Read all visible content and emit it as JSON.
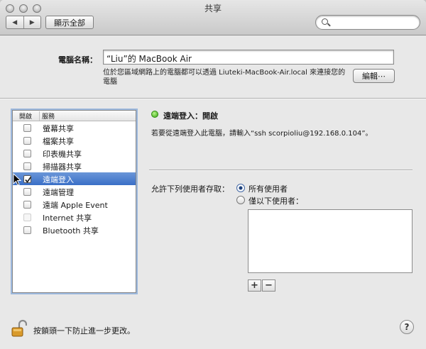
{
  "window": {
    "title": "共享"
  },
  "toolbar": {
    "back": "◀",
    "forward": "▶",
    "show_all": "顯示全部",
    "search_value": "",
    "search_placeholder": ""
  },
  "computer_name": {
    "label": "電腦名稱：",
    "value": "“Liu”的 MacBook Air",
    "address_note": "位於您區域網路上的電腦都可以透過 Liuteki-MacBook-Air.local 來連接您的電腦",
    "edit_button": "編輯⋯"
  },
  "services": {
    "col_on": "開啟",
    "col_service": "服務",
    "items": [
      {
        "label": "螢幕共享",
        "checked": false,
        "enabled": true,
        "selected": false
      },
      {
        "label": "檔案共享",
        "checked": false,
        "enabled": true,
        "selected": false
      },
      {
        "label": "印表機共享",
        "checked": false,
        "enabled": true,
        "selected": false
      },
      {
        "label": "掃描器共享",
        "checked": false,
        "enabled": true,
        "selected": false
      },
      {
        "label": "遠端登入",
        "checked": true,
        "enabled": true,
        "selected": true
      },
      {
        "label": "遠端管理",
        "checked": false,
        "enabled": true,
        "selected": false
      },
      {
        "label": "遠端 Apple Event",
        "checked": false,
        "enabled": true,
        "selected": false
      },
      {
        "label": "Internet 共享",
        "checked": false,
        "enabled": false,
        "selected": false
      },
      {
        "label": "Bluetooth 共享",
        "checked": false,
        "enabled": true,
        "selected": false
      }
    ]
  },
  "detail": {
    "status": "遠端登入：開啟",
    "status_color": "#38a711",
    "ssh_hint": "若要從遠端登入此電腦，請輸入“ssh scorpioliu@192.168.0.104”。",
    "allow_label": "允許下列使用者存取：",
    "radio_all": "所有使用者",
    "radio_only": "僅以下使用者：",
    "radio_selected": "all",
    "add": "+",
    "remove": "−"
  },
  "footer": {
    "lock_text": "按鎖頭一下防止進一步更改。",
    "help": "?"
  }
}
